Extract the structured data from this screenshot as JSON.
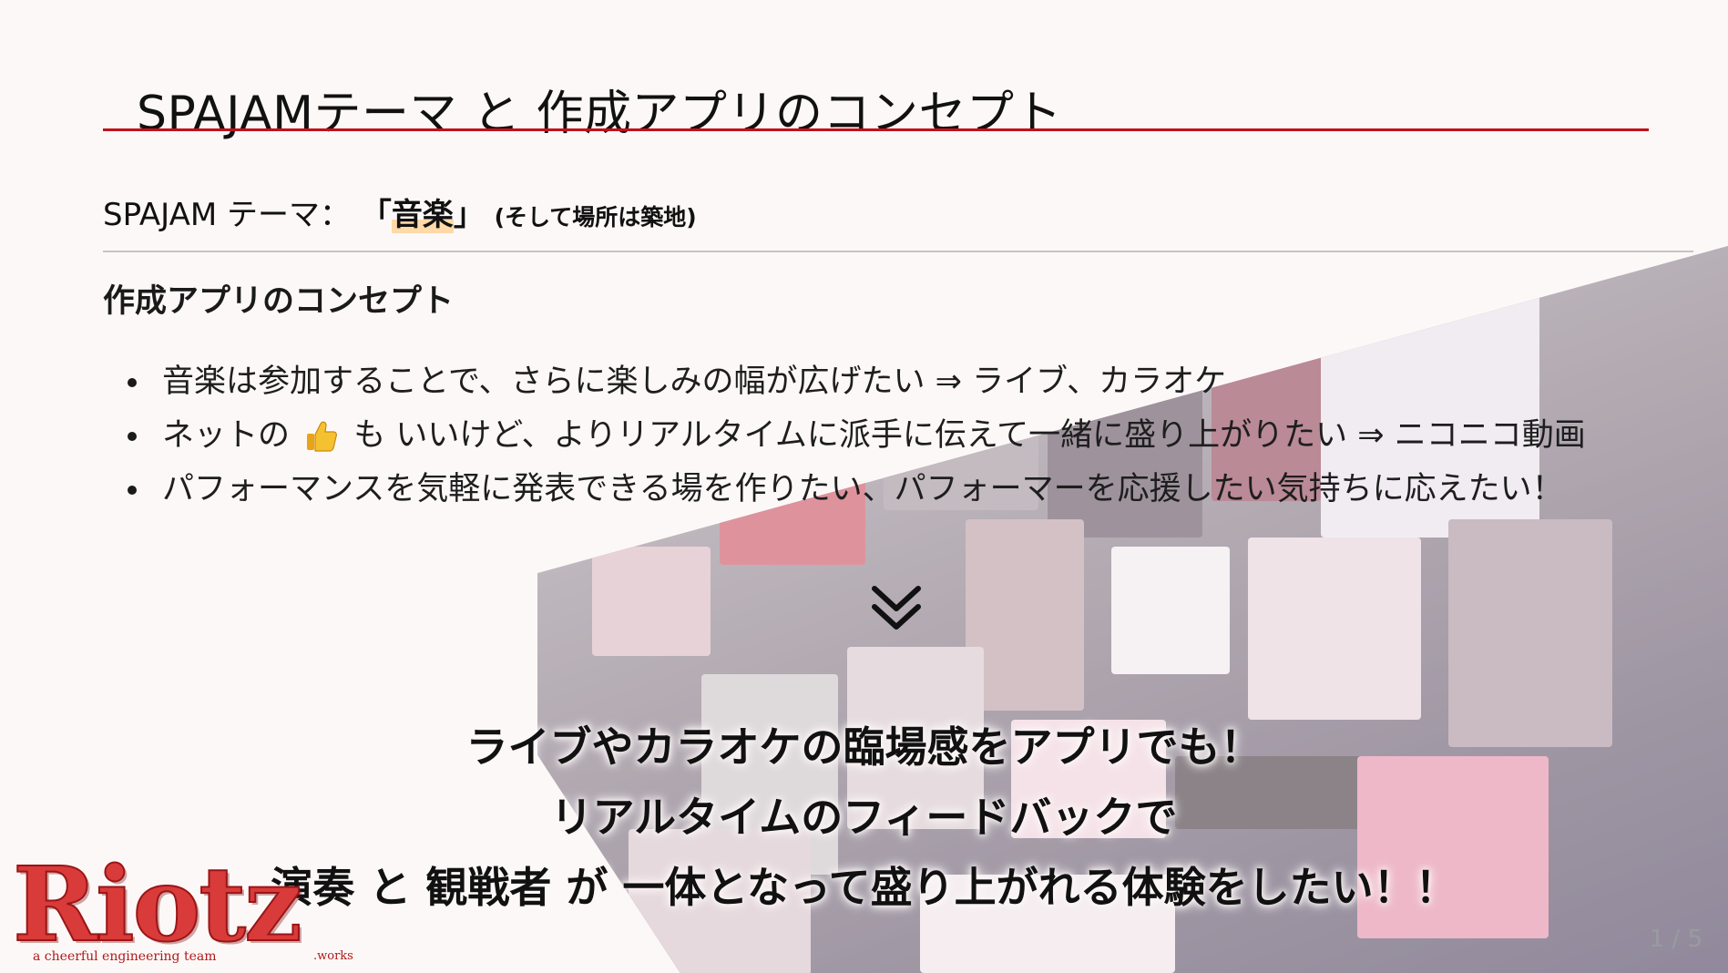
{
  "slide": {
    "title": "SPAJAMテーマ と 作成アプリのコンセプト",
    "theme": {
      "label": "SPAJAM テーマ：",
      "value_open": "「",
      "value": "音楽",
      "value_close": "」",
      "note": "(そして場所は築地)"
    },
    "concept_heading": "作成アプリのコンセプト",
    "bullets": [
      {
        "text": "音楽は参加することで、さらに楽しみの幅が広げたい ⇒ ライブ、カラオケ"
      },
      {
        "before": "ネットの",
        "icon": "thumbs-up-icon",
        "after": "も いいけど、よりリアルタイムに派手に伝えて一緒に盛り上がりたい ⇒ ニコニコ動画"
      },
      {
        "text": "パフォーマンスを気軽に発表できる場を作りたい、パフォーマーを応援したい気持ちに応えたい！"
      }
    ],
    "arrow_icon": "double-chevron-down-icon",
    "conclusion": [
      "ライブやカラオケの臨場感をアプリでも！",
      "リアルタイムのフィードバックで",
      "演奏 と 観戦者 が 一体となって盛り上がれる体験をしたい！！"
    ],
    "logo": {
      "word": "Riotz",
      "tagline": "a cheerful engineering team",
      "suffix": ".works"
    },
    "page_number": "1 / 5",
    "colors": {
      "accent": "#c0121a",
      "highlight": "#ffd9a8",
      "background": "#fdf8f8"
    }
  }
}
